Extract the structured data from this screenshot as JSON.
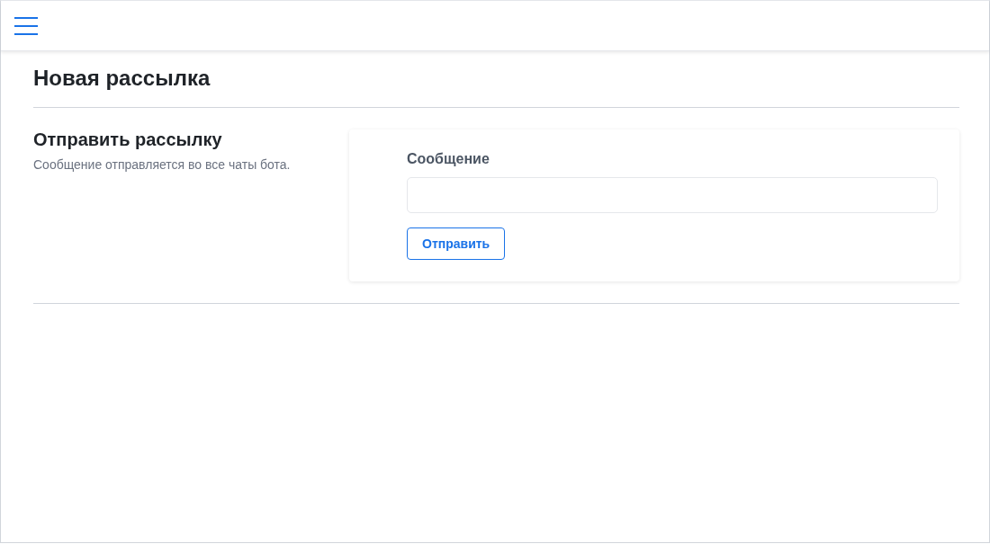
{
  "page": {
    "title": "Новая рассылка"
  },
  "section": {
    "title": "Отправить рассылку",
    "description": "Сообщение отправляется во все чаты бота."
  },
  "form": {
    "field_label": "Сообщение",
    "submit": "Отправить"
  }
}
